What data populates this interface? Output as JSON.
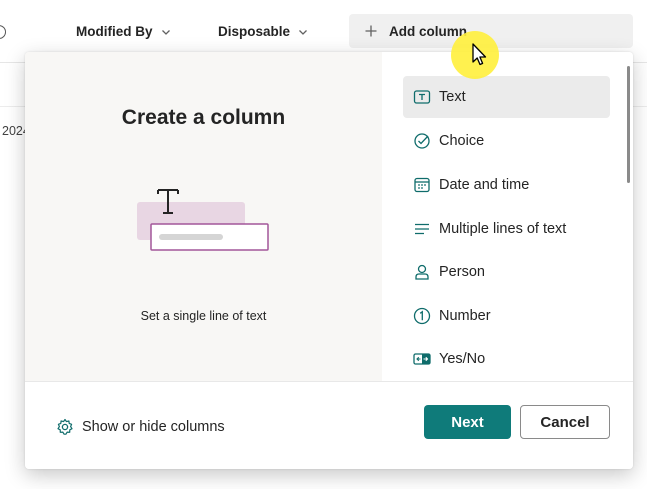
{
  "list": {
    "columns": [
      {
        "label": "Modified By"
      },
      {
        "label": "Disposable"
      }
    ],
    "add_column_label": "Add column",
    "partial_cell": "2024"
  },
  "dialog": {
    "title": "Create a column",
    "description": "Set a single line of text",
    "column_types": [
      {
        "label": "Text",
        "icon": "text-field-icon",
        "selected": true
      },
      {
        "label": "Choice",
        "icon": "choice-check-icon",
        "selected": false
      },
      {
        "label": "Date and time",
        "icon": "calendar-icon",
        "selected": false
      },
      {
        "label": "Multiple lines of text",
        "icon": "multiline-text-icon",
        "selected": false
      },
      {
        "label": "Person",
        "icon": "person-icon",
        "selected": false
      },
      {
        "label": "Number",
        "icon": "number-icon",
        "selected": false
      },
      {
        "label": "Yes/No",
        "icon": "yes-no-toggle-icon",
        "selected": false
      }
    ],
    "show_hide_label": "Show or hide columns",
    "next_label": "Next",
    "cancel_label": "Cancel"
  },
  "colors": {
    "accent": "#0f7b7a",
    "illustration_pink": "#e8d6e3",
    "illustration_border": "#a2569a"
  }
}
